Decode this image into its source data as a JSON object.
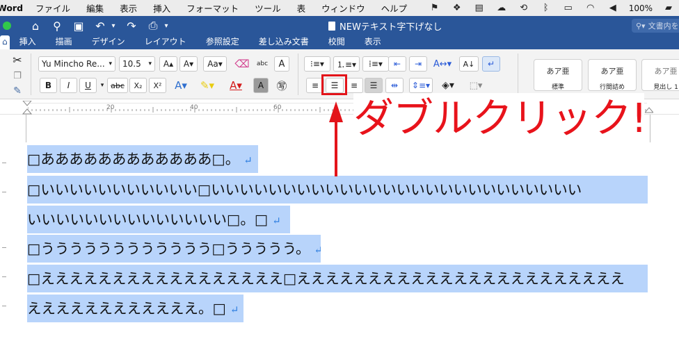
{
  "menubar": {
    "app": "Word",
    "items": [
      "ファイル",
      "編集",
      "表示",
      "挿入",
      "フォーマット",
      "ツール",
      "表",
      "ウィンドウ",
      "ヘルプ"
    ],
    "battery": "100%"
  },
  "window": {
    "title": "NEWテキスト字下げなし",
    "search_placeholder": "文書内を"
  },
  "tabs": [
    "ホーム",
    "挿入",
    "描画",
    "デザイン",
    "レイアウト",
    "参照設定",
    "差し込み文書",
    "校閲",
    "表示"
  ],
  "ribbon": {
    "font_name": "Yu Mincho Re...",
    "font_size": "10.5",
    "bold": "B",
    "italic": "I",
    "underline": "U",
    "strike": "abc",
    "subscript": "X₂",
    "superscript": "X²",
    "styles": [
      {
        "sample": "あア亜",
        "caption": "標準"
      },
      {
        "sample": "あア亜",
        "caption": "行間詰め"
      },
      {
        "sample": "あア亜",
        "caption": "見出し 1"
      }
    ]
  },
  "ruler": {
    "ticks": [
      "20",
      "40",
      "60"
    ]
  },
  "annotation": {
    "text": "ダブルクリック!"
  },
  "document": {
    "lines": [
      "□ああああああああああああ□。",
      "□いいいいいいいいいいい□いいいいいいいいいいいいいいいいいいいいいいいいいい",
      "いいいいいいいいいいいいいい□。□",
      "□うううううううううううう□ううううう。",
      "□えええええええええええええええええ□えええええええええええええええええええええええ",
      "ええええええええええええ。□"
    ],
    "return_mark": "↵"
  }
}
